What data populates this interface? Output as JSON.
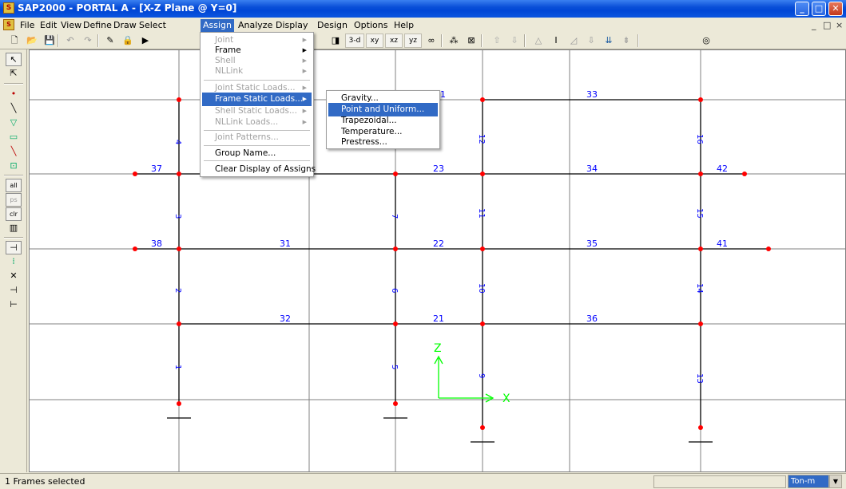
{
  "window": {
    "title": "SAP2000 - PORTAL A - [X-Z Plane @ Y=0]",
    "app_icon": "sap-logo-icon",
    "controls": [
      "_",
      "□",
      "✕"
    ]
  },
  "menubar": {
    "items": [
      "File",
      "Edit",
      "View",
      "Define",
      "Draw",
      "Select",
      "Assign",
      "Analyze",
      "Display",
      "Design",
      "Options",
      "Help"
    ],
    "active": "Assign",
    "mdi_controls": [
      "_",
      "□",
      "×"
    ]
  },
  "toolbar": {
    "view_buttons": [
      "3-d",
      "xy",
      "xz",
      "yz"
    ]
  },
  "assign_menu": {
    "items": [
      {
        "label": "Joint",
        "disabled": true,
        "submenu": true
      },
      {
        "label": "Frame",
        "disabled": false,
        "submenu": true
      },
      {
        "label": "Shell",
        "disabled": true,
        "submenu": true
      },
      {
        "label": "NLLink",
        "disabled": true,
        "submenu": true
      },
      {
        "label": "Joint Static Loads...",
        "disabled": true,
        "submenu": true
      },
      {
        "label": "Frame Static Loads...",
        "disabled": false,
        "submenu": true,
        "highlighted": true
      },
      {
        "label": "Shell Static Loads...",
        "disabled": true,
        "submenu": true
      },
      {
        "label": "NLLink Loads...",
        "disabled": true,
        "submenu": true
      },
      {
        "label": "Joint Patterns...",
        "disabled": true,
        "submenu": false
      },
      {
        "label": "Group Name...",
        "disabled": false,
        "submenu": false
      },
      {
        "label": "Clear Display of Assigns",
        "disabled": false,
        "submenu": false
      }
    ]
  },
  "frame_loads_submenu": {
    "items": [
      {
        "label": "Gravity...",
        "highlighted": false
      },
      {
        "label": "Point and Uniform...",
        "highlighted": true
      },
      {
        "label": "Trapezoidal...",
        "highlighted": false
      },
      {
        "label": "Temperature...",
        "highlighted": false
      },
      {
        "label": "Prestress...",
        "highlighted": false
      }
    ]
  },
  "model": {
    "beam_labels": [
      "33",
      "23",
      "34",
      "42",
      "37",
      "38",
      "31",
      "22",
      "35",
      "41",
      "32",
      "21",
      "36",
      "1"
    ],
    "column_labels": [
      "4",
      "3",
      "2",
      "1",
      "7",
      "6",
      "5",
      "12",
      "11",
      "10",
      "9",
      "16",
      "15",
      "14",
      "13"
    ],
    "axis_labels": {
      "z": "Z",
      "x": "X"
    },
    "colors": {
      "member": "#000000",
      "joint": "#ff0000",
      "label": "#0000ff",
      "axis": "#00ff00",
      "grid": "#808080"
    }
  },
  "status": {
    "text": "1 Frames selected",
    "units": "Ton-m"
  }
}
